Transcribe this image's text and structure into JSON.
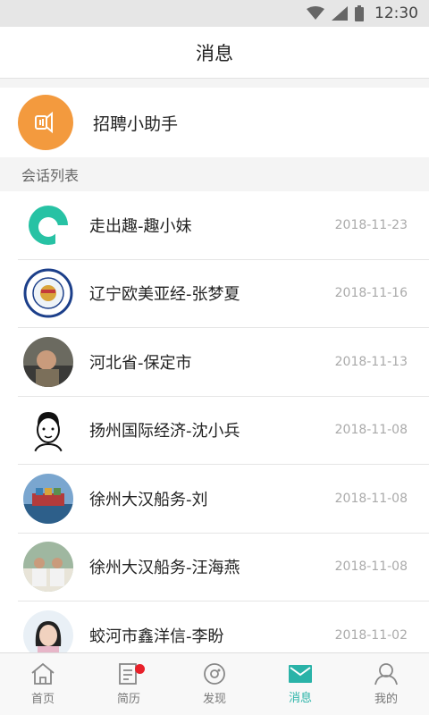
{
  "status": {
    "time": "12:30"
  },
  "header": {
    "title": "消息"
  },
  "assistant": {
    "label": "招聘小助手"
  },
  "section": {
    "title": "会话列表"
  },
  "conversations": [
    {
      "name": "走出趣-趣小妹",
      "date": "2018-11-23",
      "avatar": "qu-logo-icon"
    },
    {
      "name": "辽宁欧美亚经-张梦夏",
      "date": "2018-11-16",
      "avatar": "company-seal-avatar"
    },
    {
      "name": "河北省-保定市",
      "date": "2018-11-13",
      "avatar": "photo-avatar"
    },
    {
      "name": "扬州国际经济-沈小兵",
      "date": "2018-11-08",
      "avatar": "cartoon-avatar"
    },
    {
      "name": "徐州大汉船务-刘",
      "date": "2018-11-08",
      "avatar": "ship-photo-avatar"
    },
    {
      "name": "徐州大汉船务-汪海燕",
      "date": "2018-11-08",
      "avatar": "crew-photo-avatar"
    },
    {
      "name": "蛟河市鑫洋信-李盼",
      "date": "2018-11-02",
      "avatar": "woman-photo-avatar"
    }
  ],
  "tabs": [
    {
      "label": "首页",
      "icon": "home-icon"
    },
    {
      "label": "简历",
      "icon": "resume-icon"
    },
    {
      "label": "发现",
      "icon": "discover-icon"
    },
    {
      "label": "消息",
      "icon": "message-icon",
      "active": true
    },
    {
      "label": "我的",
      "icon": "profile-icon"
    }
  ],
  "colors": {
    "accent": "#2ab3a8",
    "assistant": "#f39a3e",
    "badge": "#e8202a"
  }
}
